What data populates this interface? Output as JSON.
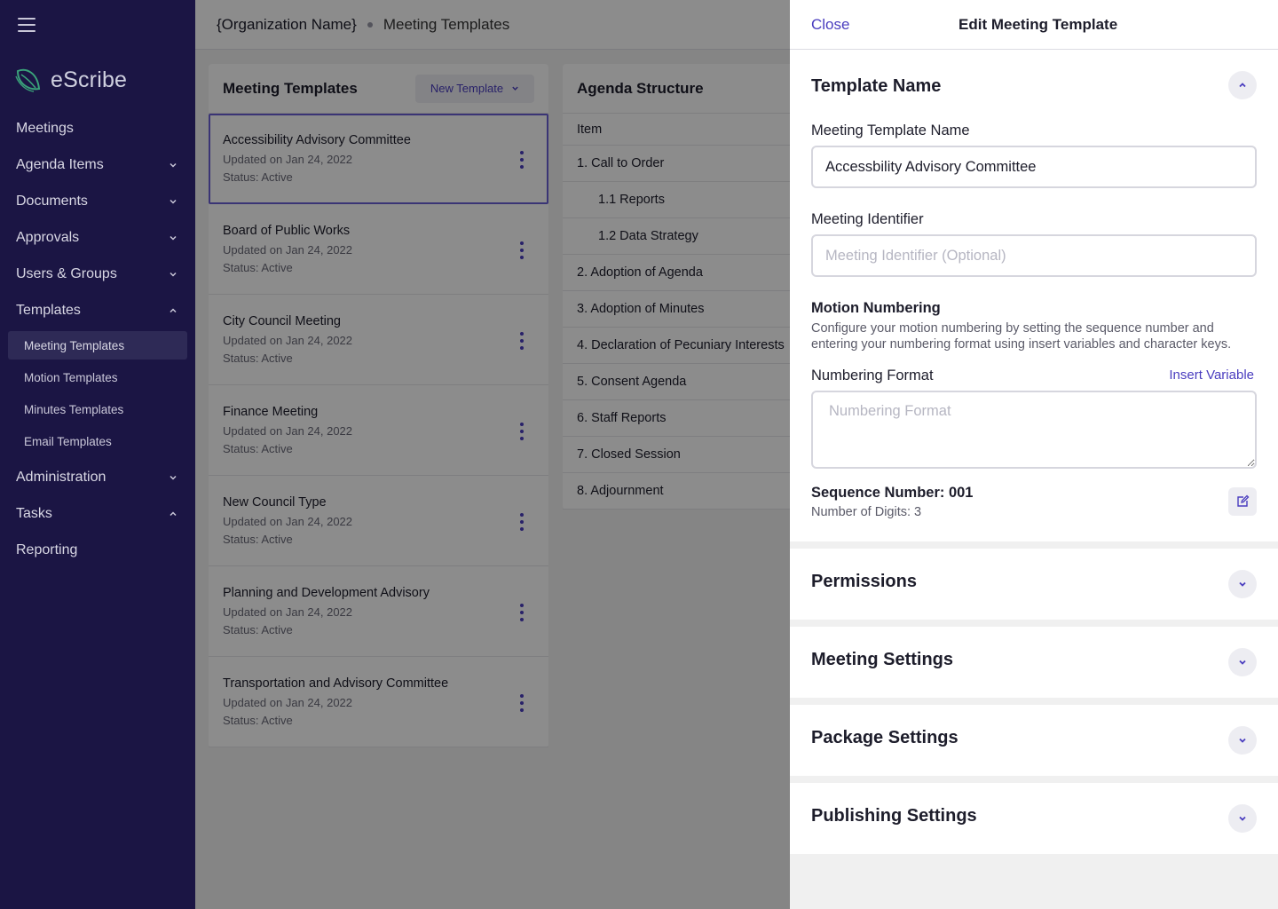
{
  "app": {
    "name": "eScribe"
  },
  "sidebar": {
    "items": [
      {
        "label": "Meetings",
        "chevron": "none"
      },
      {
        "label": "Agenda Items",
        "chevron": "down"
      },
      {
        "label": "Documents",
        "chevron": "down"
      },
      {
        "label": "Approvals",
        "chevron": "down"
      },
      {
        "label": "Users & Groups",
        "chevron": "down"
      },
      {
        "label": "Templates",
        "chevron": "up"
      }
    ],
    "sub_items": [
      {
        "label": "Meeting Templates",
        "active": true
      },
      {
        "label": "Motion Templates"
      },
      {
        "label": "Minutes Templates"
      },
      {
        "label": "Email Templates"
      }
    ],
    "items_after": [
      {
        "label": "Administration",
        "chevron": "down"
      },
      {
        "label": "Tasks",
        "chevron": "up"
      },
      {
        "label": "Reporting",
        "chevron": "none"
      }
    ]
  },
  "breadcrumb": {
    "org": "{Organization Name}",
    "page": "Meeting Templates"
  },
  "templates_panel": {
    "title": "Meeting Templates",
    "new_button": "New Template",
    "items": [
      {
        "name": "Accessibility Advisory Committee",
        "updated": "Updated on Jan 24, 2022",
        "status": "Status: Active",
        "selected": true
      },
      {
        "name": "Board of Public Works",
        "updated": "Updated on Jan 24, 2022",
        "status": "Status: Active"
      },
      {
        "name": "City Council Meeting",
        "updated": "Updated on Jan 24, 2022",
        "status": "Status: Active"
      },
      {
        "name": "Finance Meeting",
        "updated": "Updated on Jan 24, 2022",
        "status": "Status: Active"
      },
      {
        "name": "New Council Type",
        "updated": "Updated on Jan 24, 2022",
        "status": "Status: Active"
      },
      {
        "name": "Planning and Development Advisory",
        "updated": "Updated on Jan 24, 2022",
        "status": "Status: Active"
      },
      {
        "name": "Transportation and Advisory Committee",
        "updated": "Updated on Jan 24, 2022",
        "status": "Status: Active"
      }
    ]
  },
  "agenda_panel": {
    "title": "Agenda Structure",
    "column": "Item",
    "rows": [
      {
        "label": "1. Call to Order",
        "sub": false
      },
      {
        "label": "1.1  Reports",
        "sub": true
      },
      {
        "label": "1.2  Data Strategy",
        "sub": true
      },
      {
        "label": "2. Adoption of Agenda",
        "sub": false
      },
      {
        "label": "3. Adoption of Minutes",
        "sub": false
      },
      {
        "label": "4. Declaration of Pecuniary Interests",
        "sub": false
      },
      {
        "label": "5. Consent Agenda",
        "sub": false
      },
      {
        "label": "6. Staff Reports",
        "sub": false
      },
      {
        "label": "7. Closed Session",
        "sub": false
      },
      {
        "label": "8. Adjournment",
        "sub": false
      }
    ]
  },
  "drawer": {
    "close_label": "Close",
    "title": "Edit Meeting Template",
    "template_name_section": {
      "title": "Template Name",
      "name_label": "Meeting Template Name",
      "name_value": "Accessbility Advisory Committee",
      "identifier_label": "Meeting Identifier",
      "identifier_placeholder": "Meeting Identifier (Optional)",
      "motion_heading": "Motion Numbering",
      "motion_desc": "Configure your motion numbering by setting the sequence number and entering your numbering format using insert variables and character keys.",
      "format_label": "Numbering Format",
      "insert_variable": "Insert Variable",
      "format_placeholder": "Numbering Format",
      "sequence": "Sequence Number: 001",
      "digits": "Number of Digits: 3"
    },
    "sections": [
      {
        "title": "Permissions"
      },
      {
        "title": "Meeting Settings"
      },
      {
        "title": "Package Settings"
      },
      {
        "title": "Publishing Settings"
      }
    ]
  },
  "colors": {
    "sidebar": "#1b1544",
    "accent": "#4a3dbf",
    "overlay": "rgba(0,0,0,0.45)"
  }
}
